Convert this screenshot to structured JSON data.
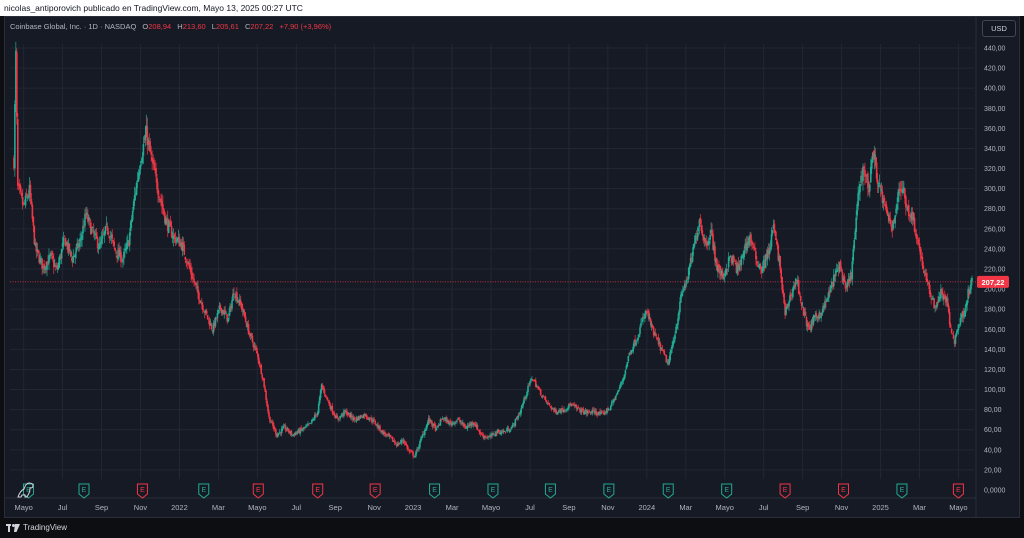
{
  "header": {
    "publisher_line": "nicolas_antiporovich publicado en TradingView.com, Mayo 13, 2025 00:27 UTC"
  },
  "legend": {
    "symbol": "Coinbase Global, Inc. · 1D · NASDAQ",
    "o_label": "O",
    "o_value": "208,94",
    "h_label": "H",
    "h_value": "213,60",
    "l_label": "L",
    "l_value": "205,61",
    "c_label": "C",
    "c_value": "207,22",
    "change": "+7,90 (+3,96%)"
  },
  "currency_button": "USD",
  "footer": {
    "brand": "TradingView"
  },
  "colors": {
    "up": "#22ab94",
    "down": "#f23645",
    "background": "#161a25",
    "grid": "#232734",
    "axis_text": "#b2b5be",
    "price_line": "#f23645"
  },
  "chart_data": {
    "type": "candlestick",
    "title": "",
    "xlabel": "",
    "ylabel": "",
    "ylim": [
      0,
      450
    ],
    "grid": true,
    "y_ticks": [
      0,
      20,
      40,
      60,
      80,
      100,
      120,
      140,
      160,
      180,
      200,
      220,
      240,
      260,
      280,
      300,
      320,
      340,
      360,
      380,
      400,
      420,
      440
    ],
    "y_tick_labels": [
      "0,0000",
      "20,00",
      "40,00",
      "60,00",
      "80,00",
      "100,00",
      "120,00",
      "140,00",
      "160,00",
      "180,00",
      "200,00",
      "220,00",
      "240,00",
      "260,00",
      "280,00",
      "300,00",
      "320,00",
      "340,00",
      "360,00",
      "380,00",
      "400,00",
      "420,00",
      "440,00"
    ],
    "x_ticks": [
      {
        "label": "Mayo",
        "t": 0.5
      },
      {
        "label": "Jul",
        "t": 2.5
      },
      {
        "label": "Sep",
        "t": 4.5
      },
      {
        "label": "Nov",
        "t": 6.5
      },
      {
        "label": "2022",
        "t": 8.5
      },
      {
        "label": "Mar",
        "t": 10.5
      },
      {
        "label": "Mayo",
        "t": 12.5
      },
      {
        "label": "Jul",
        "t": 14.5
      },
      {
        "label": "Sep",
        "t": 16.5
      },
      {
        "label": "Nov",
        "t": 18.5
      },
      {
        "label": "2023",
        "t": 20.5
      },
      {
        "label": "Mar",
        "t": 22.5
      },
      {
        "label": "Mayo",
        "t": 24.5
      },
      {
        "label": "Jul",
        "t": 26.5
      },
      {
        "label": "Sep",
        "t": 28.5
      },
      {
        "label": "Nov",
        "t": 30.5
      },
      {
        "label": "2024",
        "t": 32.5
      },
      {
        "label": "Mar",
        "t": 34.5
      },
      {
        "label": "Mayo",
        "t": 36.5
      },
      {
        "label": "Jul",
        "t": 38.5
      },
      {
        "label": "Sep",
        "t": 40.5
      },
      {
        "label": "Nov",
        "t": 42.5
      },
      {
        "label": "2025",
        "t": 44.5
      },
      {
        "label": "Mar",
        "t": 46.5
      },
      {
        "label": "Mayo",
        "t": 48.5
      }
    ],
    "t_range": [
      -0.2,
      49.3
    ],
    "last_price": 207.22,
    "last_price_label": "207,22",
    "path": [
      [
        0.0,
        328
      ],
      [
        0.1,
        432
      ],
      [
        0.2,
        300
      ],
      [
        0.5,
        282
      ],
      [
        0.8,
        298
      ],
      [
        1.1,
        240
      ],
      [
        1.5,
        222
      ],
      [
        1.9,
        232
      ],
      [
        2.2,
        218
      ],
      [
        2.6,
        250
      ],
      [
        3.0,
        230
      ],
      [
        3.4,
        247
      ],
      [
        3.7,
        274
      ],
      [
        4.0,
        258
      ],
      [
        4.4,
        242
      ],
      [
        4.8,
        262
      ],
      [
        5.2,
        238
      ],
      [
        5.6,
        230
      ],
      [
        5.9,
        248
      ],
      [
        6.2,
        292
      ],
      [
        6.5,
        330
      ],
      [
        6.8,
        355
      ],
      [
        7.1,
        325
      ],
      [
        7.4,
        300
      ],
      [
        7.8,
        268
      ],
      [
        8.2,
        252
      ],
      [
        8.6,
        245
      ],
      [
        9.0,
        222
      ],
      [
        9.4,
        198
      ],
      [
        9.8,
        178
      ],
      [
        10.2,
        160
      ],
      [
        10.6,
        182
      ],
      [
        11.0,
        170
      ],
      [
        11.3,
        198
      ],
      [
        11.7,
        182
      ],
      [
        12.1,
        155
      ],
      [
        12.5,
        135
      ],
      [
        12.8,
        110
      ],
      [
        13.1,
        72
      ],
      [
        13.5,
        55
      ],
      [
        13.9,
        62
      ],
      [
        14.3,
        55
      ],
      [
        14.8,
        60
      ],
      [
        15.2,
        65
      ],
      [
        15.6,
        78
      ],
      [
        15.8,
        104
      ],
      [
        16.2,
        85
      ],
      [
        16.6,
        70
      ],
      [
        17.0,
        78
      ],
      [
        17.5,
        70
      ],
      [
        18.0,
        75
      ],
      [
        18.5,
        68
      ],
      [
        18.9,
        58
      ],
      [
        19.3,
        52
      ],
      [
        19.7,
        45
      ],
      [
        20.0,
        50
      ],
      [
        20.3,
        38
      ],
      [
        20.6,
        34
      ],
      [
        21.0,
        55
      ],
      [
        21.3,
        70
      ],
      [
        21.7,
        60
      ],
      [
        22.0,
        72
      ],
      [
        22.4,
        66
      ],
      [
        22.8,
        70
      ],
      [
        23.2,
        62
      ],
      [
        23.6,
        68
      ],
      [
        24.0,
        55
      ],
      [
        24.4,
        52
      ],
      [
        24.8,
        58
      ],
      [
        25.2,
        58
      ],
      [
        25.6,
        63
      ],
      [
        26.0,
        78
      ],
      [
        26.3,
        96
      ],
      [
        26.6,
        112
      ],
      [
        27.0,
        98
      ],
      [
        27.4,
        86
      ],
      [
        27.8,
        78
      ],
      [
        28.2,
        80
      ],
      [
        28.6,
        85
      ],
      [
        29.0,
        80
      ],
      [
        29.4,
        77
      ],
      [
        29.8,
        78
      ],
      [
        30.2,
        75
      ],
      [
        30.6,
        82
      ],
      [
        31.0,
        97
      ],
      [
        31.3,
        112
      ],
      [
        31.6,
        136
      ],
      [
        32.0,
        152
      ],
      [
        32.3,
        170
      ],
      [
        32.5,
        178
      ],
      [
        32.8,
        158
      ],
      [
        33.2,
        142
      ],
      [
        33.6,
        125
      ],
      [
        34.0,
        162
      ],
      [
        34.3,
        196
      ],
      [
        34.6,
        212
      ],
      [
        34.9,
        240
      ],
      [
        35.2,
        270
      ],
      [
        35.5,
        245
      ],
      [
        35.8,
        256
      ],
      [
        36.1,
        222
      ],
      [
        36.4,
        212
      ],
      [
        36.8,
        232
      ],
      [
        37.2,
        218
      ],
      [
        37.5,
        240
      ],
      [
        37.8,
        252
      ],
      [
        38.1,
        230
      ],
      [
        38.4,
        220
      ],
      [
        38.8,
        240
      ],
      [
        39.0,
        262
      ],
      [
        39.3,
        228
      ],
      [
        39.6,
        175
      ],
      [
        39.9,
        195
      ],
      [
        40.2,
        210
      ],
      [
        40.5,
        180
      ],
      [
        40.8,
        160
      ],
      [
        41.1,
        170
      ],
      [
        41.5,
        178
      ],
      [
        41.8,
        192
      ],
      [
        42.1,
        210
      ],
      [
        42.4,
        225
      ],
      [
        42.7,
        198
      ],
      [
        43.0,
        215
      ],
      [
        43.2,
        258
      ],
      [
        43.4,
        300
      ],
      [
        43.6,
        322
      ],
      [
        43.9,
        300
      ],
      [
        44.1,
        338
      ],
      [
        44.4,
        305
      ],
      [
        44.8,
        275
      ],
      [
        45.1,
        262
      ],
      [
        45.4,
        292
      ],
      [
        45.6,
        302
      ],
      [
        45.9,
        280
      ],
      [
        46.2,
        268
      ],
      [
        46.5,
        240
      ],
      [
        46.8,
        212
      ],
      [
        47.0,
        198
      ],
      [
        47.3,
        182
      ],
      [
        47.6,
        196
      ],
      [
        47.9,
        188
      ],
      [
        48.1,
        160
      ],
      [
        48.3,
        148
      ],
      [
        48.5,
        165
      ],
      [
        48.8,
        178
      ],
      [
        49.0,
        196
      ],
      [
        49.2,
        207
      ]
    ],
    "markers": [
      {
        "type": "E",
        "sentiment": "positive",
        "t": 0.75
      },
      {
        "type": "E",
        "sentiment": "positive",
        "t": 3.6
      },
      {
        "type": "E",
        "sentiment": "negative",
        "t": 6.6
      },
      {
        "type": "E",
        "sentiment": "positive",
        "t": 9.75
      },
      {
        "type": "E",
        "sentiment": "negative",
        "t": 12.55
      },
      {
        "type": "E",
        "sentiment": "negative",
        "t": 15.6
      },
      {
        "type": "E",
        "sentiment": "negative",
        "t": 18.55
      },
      {
        "type": "E",
        "sentiment": "positive",
        "t": 21.6
      },
      {
        "type": "E",
        "sentiment": "positive",
        "t": 24.6
      },
      {
        "type": "E",
        "sentiment": "positive",
        "t": 27.55
      },
      {
        "type": "E",
        "sentiment": "positive",
        "t": 30.55
      },
      {
        "type": "E",
        "sentiment": "positive",
        "t": 33.6
      },
      {
        "type": "E",
        "sentiment": "positive",
        "t": 36.6
      },
      {
        "type": "E",
        "sentiment": "negative",
        "t": 39.6
      },
      {
        "type": "E",
        "sentiment": "negative",
        "t": 42.6
      },
      {
        "type": "E",
        "sentiment": "positive",
        "t": 45.6
      },
      {
        "type": "E",
        "sentiment": "negative",
        "t": 48.5
      }
    ]
  }
}
